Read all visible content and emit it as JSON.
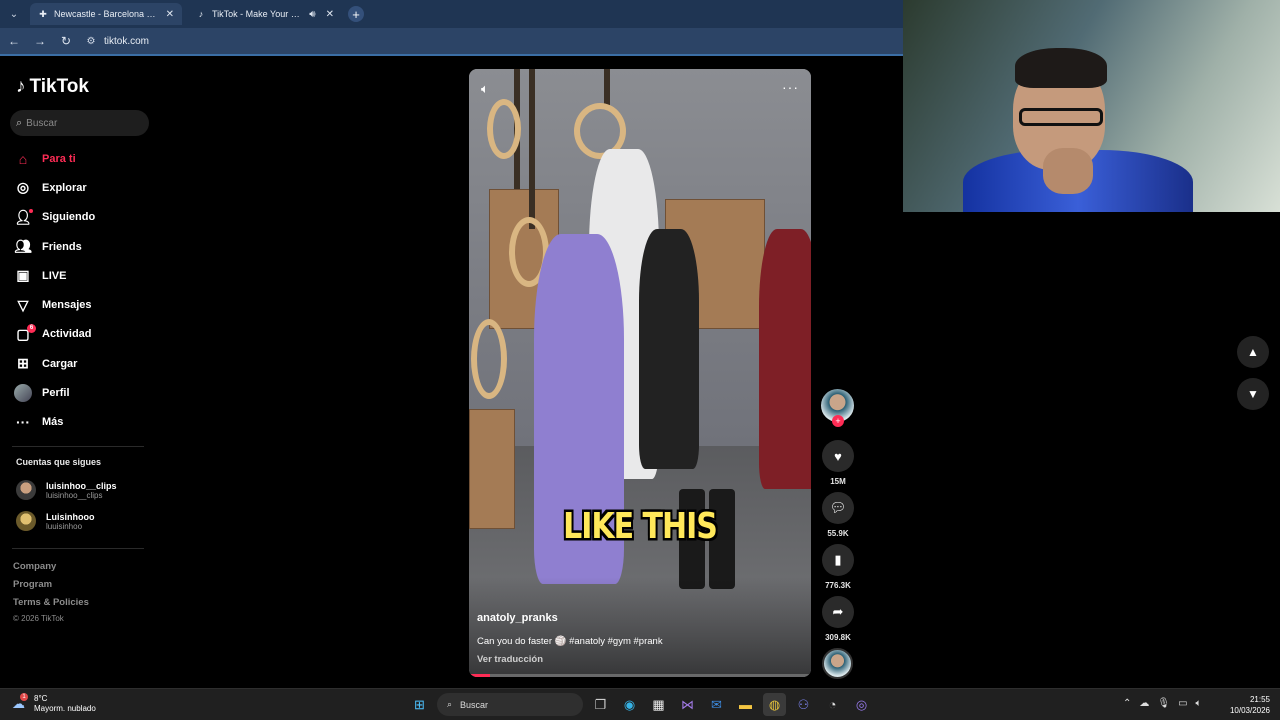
{
  "browser": {
    "tabs": [
      {
        "title": "Newcastle - Barcelona online -",
        "active": true
      },
      {
        "title": "TikTok - Make Your Day",
        "active": false
      }
    ],
    "url": "tiktok.com"
  },
  "tiktok": {
    "brand": "TikTok",
    "search_placeholder": "Buscar",
    "nav": [
      {
        "label": "Para ti",
        "icon": "home-icon",
        "active": true
      },
      {
        "label": "Explorar",
        "icon": "compass-icon"
      },
      {
        "label": "Siguiendo",
        "icon": "following-icon"
      },
      {
        "label": "Friends",
        "icon": "friends-icon"
      },
      {
        "label": "LIVE",
        "icon": "live-icon"
      },
      {
        "label": "Mensajes",
        "icon": "messages-icon"
      },
      {
        "label": "Actividad",
        "icon": "activity-icon",
        "badge": "6"
      },
      {
        "label": "Cargar",
        "icon": "upload-icon"
      },
      {
        "label": "Perfil",
        "icon": "profile-avatar"
      },
      {
        "label": "Más",
        "icon": "more-icon"
      }
    ],
    "following_header": "Cuentas que sigues",
    "following": [
      {
        "name": "luisinhoo__clips",
        "handle": "luisinhoo__clips"
      },
      {
        "name": "Luisinhooo",
        "handle": "luuisinhoo"
      }
    ],
    "footer": [
      "Company",
      "Program",
      "Terms & Policies"
    ],
    "copyright": "© 2026 TikTok"
  },
  "video": {
    "caption_overlay": "LIKE THIS",
    "author": "anatoly_pranks",
    "description": "Can you do faster 🏐 #anatoly #gym #prank",
    "translate": "Ver traducción",
    "progress": 0.06,
    "actions": {
      "likes": "15M",
      "comments": "55.9K",
      "saves": "776.3K",
      "shares": "309.8K"
    }
  },
  "taskbar": {
    "weather_temp": "8°C",
    "weather_desc": "Mayorm. nublado",
    "weather_badge": "1",
    "search_label": "Buscar",
    "time": "21:55",
    "date": "10/03/2026"
  },
  "colors": {
    "accent": "#fe2c55",
    "chrome": "#1f3553",
    "addr": "#2c4466"
  }
}
